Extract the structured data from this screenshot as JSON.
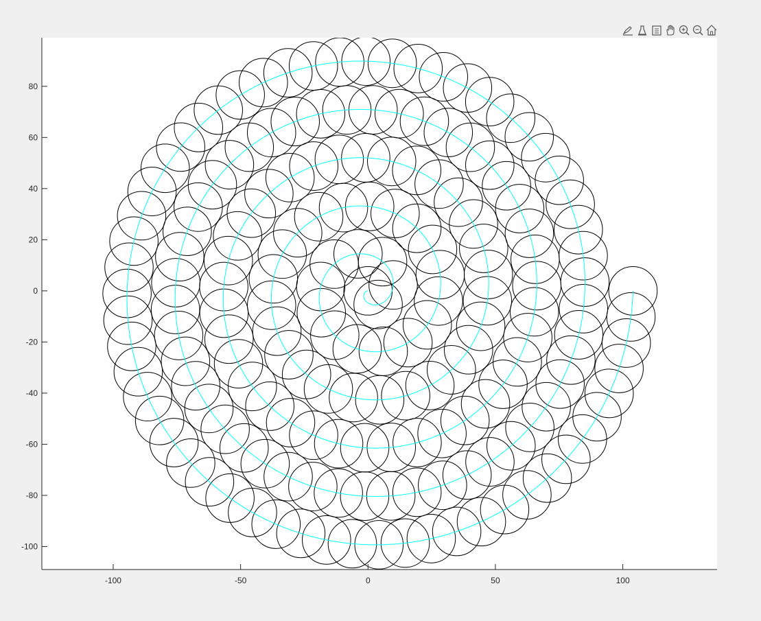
{
  "toolbar": {
    "buttons": [
      {
        "icon": "brush-edit-icon",
        "label": ""
      },
      {
        "icon": "data-tip-icon",
        "label": ""
      },
      {
        "icon": "legend-icon",
        "label": ""
      },
      {
        "icon": "pan-hand-icon",
        "label": ""
      },
      {
        "icon": "zoom-in-icon",
        "label": ""
      },
      {
        "icon": "zoom-out-icon",
        "label": ""
      },
      {
        "icon": "home-icon",
        "label": ""
      }
    ]
  },
  "chart_data": {
    "type": "line",
    "title": "",
    "xlabel": "",
    "ylabel": "",
    "xlim": [
      -128,
      137
    ],
    "ylim": [
      -109,
      99
    ],
    "xticks": [
      -100,
      -50,
      0,
      50,
      100
    ],
    "xtick_labels": [
      "-100",
      "-50",
      "0",
      "50",
      "100"
    ],
    "yticks": [
      -100,
      -80,
      -60,
      -40,
      -20,
      0,
      20,
      40,
      60,
      80
    ],
    "ytick_labels": [
      "-100",
      "-80",
      "-60",
      "-40",
      "-20",
      "0",
      "20",
      "40",
      "60",
      "80"
    ],
    "grid": false,
    "legend": "none",
    "box": "off",
    "colors": {
      "spiral": "#00ffff",
      "circles": "#000000",
      "axes_bg": "#ffffff",
      "figure_bg": "#f0f0f0",
      "axis_line": "#262626"
    },
    "series": [
      {
        "kind": "spiral",
        "description_of_curve": "Archimedean spiral r = k * theta from origin to outer end",
        "r_start": 0,
        "r_end": 104,
        "turns": 5.5,
        "end_point": [
          104,
          0
        ],
        "direction": "counterclockwise"
      },
      {
        "kind": "circles",
        "circle_radius": 9.5,
        "center_count": 175,
        "centers_follow": "spiral",
        "spacing_along_spiral": 7.2
      }
    ]
  }
}
